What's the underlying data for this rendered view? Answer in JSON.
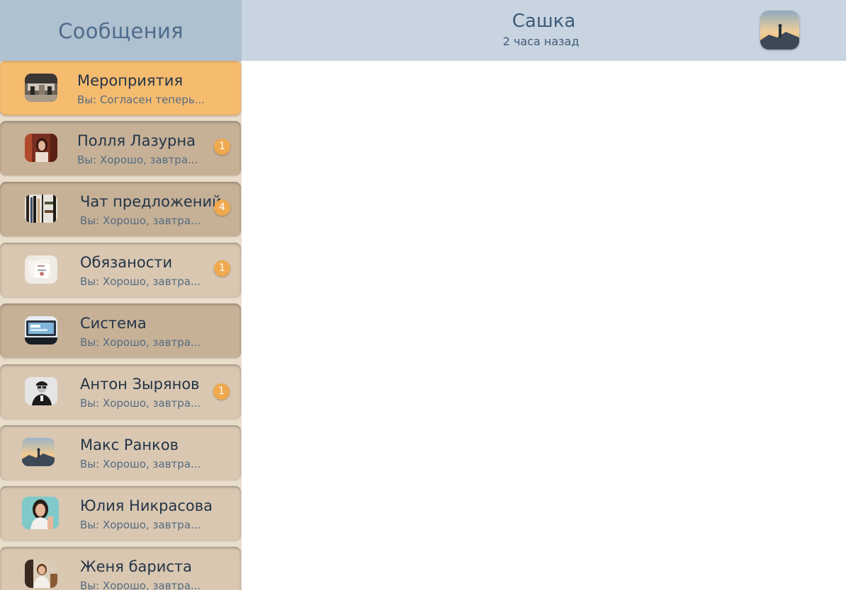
{
  "sidebar": {
    "title": "Сообщения",
    "chats": [
      {
        "name": "Мероприятия",
        "preview": "Вы: Согласен теперь...",
        "badge": "",
        "avatar": "office-photo"
      },
      {
        "name": "Полля Лазурна",
        "preview": "Вы: Хорошо, завтра...",
        "badge": "1",
        "avatar": "woman-portrait-photo"
      },
      {
        "name": "Чат предложений",
        "preview": "Вы: Хорошо, завтра...",
        "badge": "4",
        "avatar": "bookshelf-photo"
      },
      {
        "name": "Обязаности",
        "preview": "Вы: Хорошо, завтра...",
        "badge": "1",
        "avatar": "documents-photo"
      },
      {
        "name": "Система",
        "preview": "Вы: Хорошо, завтра...",
        "badge": "",
        "avatar": "laptop-photo"
      },
      {
        "name": "Антон Зырянов",
        "preview": "Вы: Хорошо, завтра...",
        "badge": "1",
        "avatar": "man-portrait-photo"
      },
      {
        "name": "Макс Ранков",
        "preview": "Вы: Хорошо, завтра...",
        "badge": "",
        "avatar": "mountain-sunset-photo"
      },
      {
        "name": "Юлия Никрасова",
        "preview": "Вы: Хорошо, завтра...",
        "badge": "",
        "avatar": "woman-smiling-photo"
      },
      {
        "name": "Женя бариста",
        "preview": "Вы: Хорошо, завтра...",
        "badge": "",
        "avatar": "barista-photo"
      }
    ]
  },
  "header": {
    "contact_name": "Сашка",
    "status": "2 часа назад",
    "avatar": "mountain-sunset-photo"
  },
  "colors": {
    "sidebar_header": "#afc0d0",
    "topbar": "#c8d5e1",
    "active_item": "#f5bb6f",
    "badge": "#f0a94e",
    "item_dark": "#c6b197",
    "item_light": "#d9c7b1"
  }
}
